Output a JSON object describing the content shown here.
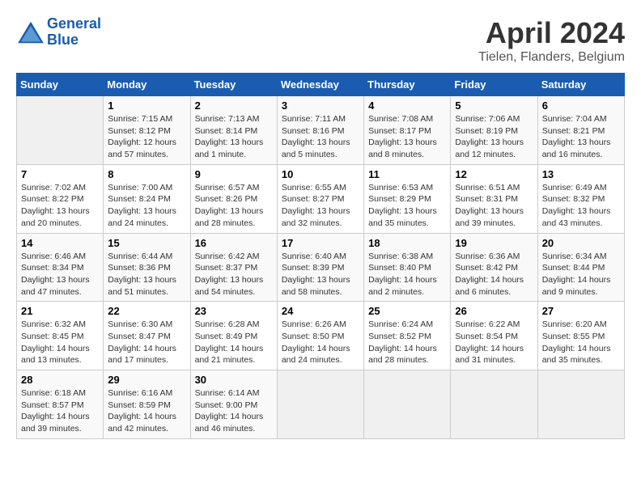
{
  "header": {
    "logo_line1": "General",
    "logo_line2": "Blue",
    "title": "April 2024",
    "subtitle": "Tielen, Flanders, Belgium"
  },
  "calendar": {
    "days_of_week": [
      "Sunday",
      "Monday",
      "Tuesday",
      "Wednesday",
      "Thursday",
      "Friday",
      "Saturday"
    ],
    "weeks": [
      [
        {
          "day": "",
          "info": ""
        },
        {
          "day": "1",
          "info": "Sunrise: 7:15 AM\nSunset: 8:12 PM\nDaylight: 12 hours\nand 57 minutes."
        },
        {
          "day": "2",
          "info": "Sunrise: 7:13 AM\nSunset: 8:14 PM\nDaylight: 13 hours\nand 1 minute."
        },
        {
          "day": "3",
          "info": "Sunrise: 7:11 AM\nSunset: 8:16 PM\nDaylight: 13 hours\nand 5 minutes."
        },
        {
          "day": "4",
          "info": "Sunrise: 7:08 AM\nSunset: 8:17 PM\nDaylight: 13 hours\nand 8 minutes."
        },
        {
          "day": "5",
          "info": "Sunrise: 7:06 AM\nSunset: 8:19 PM\nDaylight: 13 hours\nand 12 minutes."
        },
        {
          "day": "6",
          "info": "Sunrise: 7:04 AM\nSunset: 8:21 PM\nDaylight: 13 hours\nand 16 minutes."
        }
      ],
      [
        {
          "day": "7",
          "info": "Sunrise: 7:02 AM\nSunset: 8:22 PM\nDaylight: 13 hours\nand 20 minutes."
        },
        {
          "day": "8",
          "info": "Sunrise: 7:00 AM\nSunset: 8:24 PM\nDaylight: 13 hours\nand 24 minutes."
        },
        {
          "day": "9",
          "info": "Sunrise: 6:57 AM\nSunset: 8:26 PM\nDaylight: 13 hours\nand 28 minutes."
        },
        {
          "day": "10",
          "info": "Sunrise: 6:55 AM\nSunset: 8:27 PM\nDaylight: 13 hours\nand 32 minutes."
        },
        {
          "day": "11",
          "info": "Sunrise: 6:53 AM\nSunset: 8:29 PM\nDaylight: 13 hours\nand 35 minutes."
        },
        {
          "day": "12",
          "info": "Sunrise: 6:51 AM\nSunset: 8:31 PM\nDaylight: 13 hours\nand 39 minutes."
        },
        {
          "day": "13",
          "info": "Sunrise: 6:49 AM\nSunset: 8:32 PM\nDaylight: 13 hours\nand 43 minutes."
        }
      ],
      [
        {
          "day": "14",
          "info": "Sunrise: 6:46 AM\nSunset: 8:34 PM\nDaylight: 13 hours\nand 47 minutes."
        },
        {
          "day": "15",
          "info": "Sunrise: 6:44 AM\nSunset: 8:36 PM\nDaylight: 13 hours\nand 51 minutes."
        },
        {
          "day": "16",
          "info": "Sunrise: 6:42 AM\nSunset: 8:37 PM\nDaylight: 13 hours\nand 54 minutes."
        },
        {
          "day": "17",
          "info": "Sunrise: 6:40 AM\nSunset: 8:39 PM\nDaylight: 13 hours\nand 58 minutes."
        },
        {
          "day": "18",
          "info": "Sunrise: 6:38 AM\nSunset: 8:40 PM\nDaylight: 14 hours\nand 2 minutes."
        },
        {
          "day": "19",
          "info": "Sunrise: 6:36 AM\nSunset: 8:42 PM\nDaylight: 14 hours\nand 6 minutes."
        },
        {
          "day": "20",
          "info": "Sunrise: 6:34 AM\nSunset: 8:44 PM\nDaylight: 14 hours\nand 9 minutes."
        }
      ],
      [
        {
          "day": "21",
          "info": "Sunrise: 6:32 AM\nSunset: 8:45 PM\nDaylight: 14 hours\nand 13 minutes."
        },
        {
          "day": "22",
          "info": "Sunrise: 6:30 AM\nSunset: 8:47 PM\nDaylight: 14 hours\nand 17 minutes."
        },
        {
          "day": "23",
          "info": "Sunrise: 6:28 AM\nSunset: 8:49 PM\nDaylight: 14 hours\nand 21 minutes."
        },
        {
          "day": "24",
          "info": "Sunrise: 6:26 AM\nSunset: 8:50 PM\nDaylight: 14 hours\nand 24 minutes."
        },
        {
          "day": "25",
          "info": "Sunrise: 6:24 AM\nSunset: 8:52 PM\nDaylight: 14 hours\nand 28 minutes."
        },
        {
          "day": "26",
          "info": "Sunrise: 6:22 AM\nSunset: 8:54 PM\nDaylight: 14 hours\nand 31 minutes."
        },
        {
          "day": "27",
          "info": "Sunrise: 6:20 AM\nSunset: 8:55 PM\nDaylight: 14 hours\nand 35 minutes."
        }
      ],
      [
        {
          "day": "28",
          "info": "Sunrise: 6:18 AM\nSunset: 8:57 PM\nDaylight: 14 hours\nand 39 minutes."
        },
        {
          "day": "29",
          "info": "Sunrise: 6:16 AM\nSunset: 8:59 PM\nDaylight: 14 hours\nand 42 minutes."
        },
        {
          "day": "30",
          "info": "Sunrise: 6:14 AM\nSunset: 9:00 PM\nDaylight: 14 hours\nand 46 minutes."
        },
        {
          "day": "",
          "info": ""
        },
        {
          "day": "",
          "info": ""
        },
        {
          "day": "",
          "info": ""
        },
        {
          "day": "",
          "info": ""
        }
      ]
    ]
  }
}
